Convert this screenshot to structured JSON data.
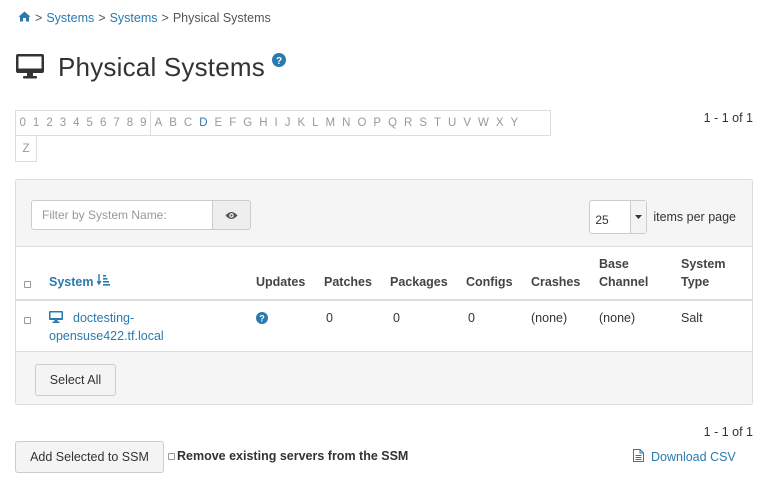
{
  "breadcrumb": {
    "home_icon": "home-icon",
    "sep": ">",
    "items": [
      "Systems",
      "Systems"
    ],
    "current": "Physical Systems"
  },
  "title": "Physical Systems",
  "alphabet": {
    "digits": [
      "0",
      "1",
      "2",
      "3",
      "4",
      "5",
      "6",
      "7",
      "8",
      "9"
    ],
    "letters": [
      "A",
      "B",
      "C",
      "D",
      "E",
      "F",
      "G",
      "H",
      "I",
      "J",
      "K",
      "L",
      "M",
      "N",
      "O",
      "P",
      "Q",
      "R",
      "S",
      "T",
      "U",
      "V",
      "W",
      "X",
      "Y"
    ],
    "overflow": [
      "Z"
    ],
    "active": "D"
  },
  "pagination": {
    "top": "1 - 1 of 1",
    "bottom": "1 - 1 of 1"
  },
  "filter": {
    "placeholder": "Filter by System Name:"
  },
  "per_page": {
    "value": "25",
    "label": "items per page"
  },
  "table": {
    "columns": {
      "system": "System",
      "updates": "Updates",
      "patches": "Patches",
      "packages": "Packages",
      "configs": "Configs",
      "crashes": "Crashes",
      "base_channel": "Base Channel",
      "system_type": "System Type"
    },
    "rows": [
      {
        "system_line1": "doctesting-",
        "system_line2": "opensuse422.tf.local",
        "patches": "0",
        "packages": "0",
        "configs": "0",
        "crashes": "(none)",
        "base_channel": "(none)",
        "system_type": "Salt"
      }
    ]
  },
  "buttons": {
    "select_all": "Select All",
    "add_ssm": "Add Selected to SSM"
  },
  "remove_ssm": "Remove existing servers from the SSM",
  "download_csv": "Download CSV",
  "colors": {
    "link": "#2a7ab0",
    "panel": "#f5f5f5",
    "border": "#dddddd"
  }
}
